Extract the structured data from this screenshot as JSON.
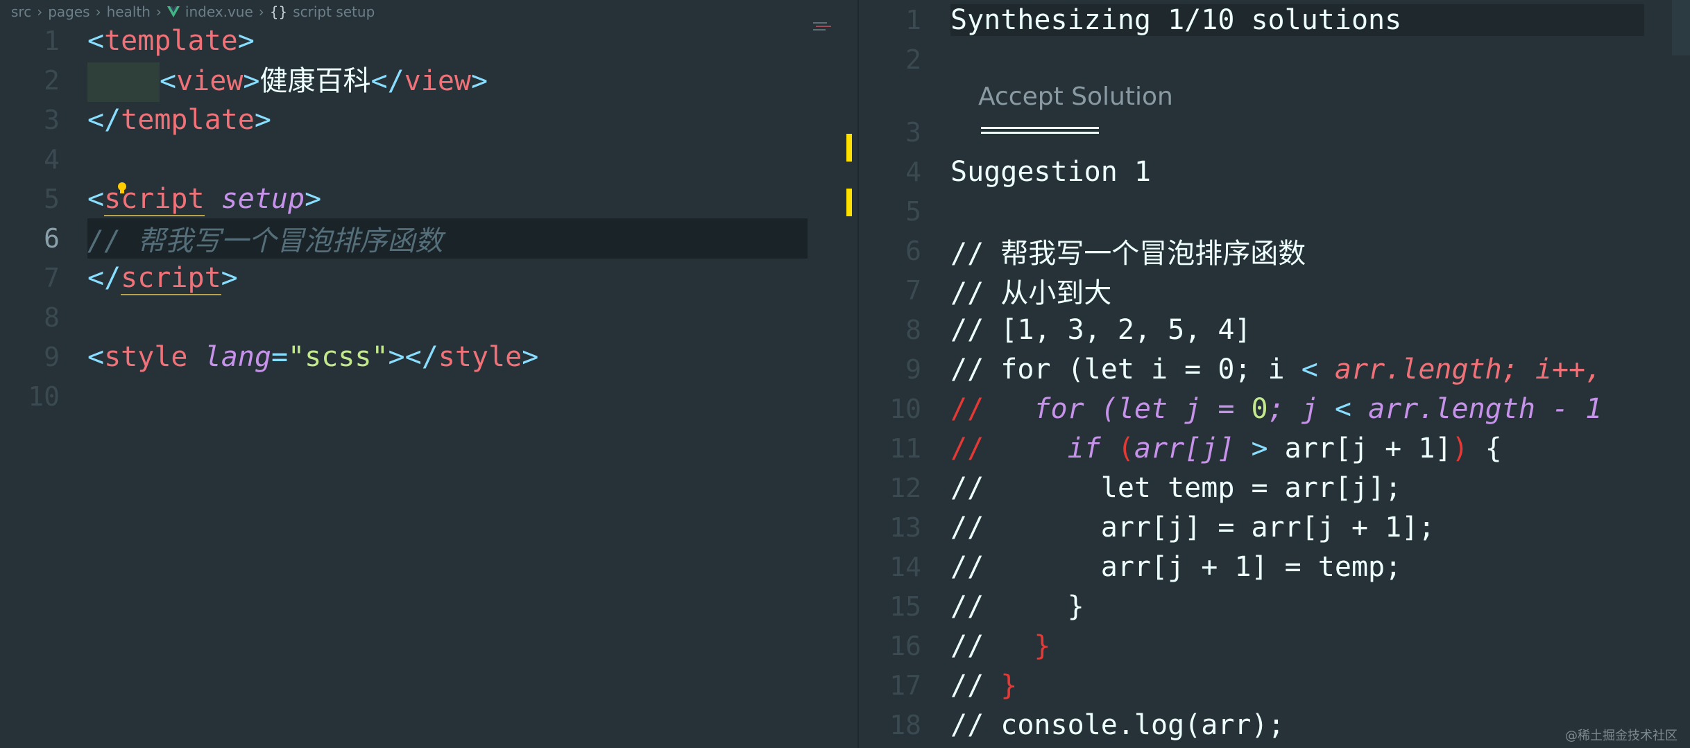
{
  "breadcrumb": [
    "src",
    "pages",
    "health",
    "index.vue",
    "script setup"
  ],
  "left_editor": {
    "line_numbers": [
      "1",
      "2",
      "3",
      "4",
      "5",
      "6",
      "7",
      "8",
      "9",
      "10"
    ],
    "active_line": "6",
    "lines": {
      "l1": {
        "open": "<",
        "tag": "template",
        "close": ">"
      },
      "l2": {
        "open": "<",
        "tag": "view",
        "close": ">",
        "text": "健康百科",
        "open2": "</",
        "tag2": "view",
        "close2": ">"
      },
      "l3": {
        "open": "</",
        "tag": "template",
        "close": ">"
      },
      "l5": {
        "open": "<",
        "tag": "script",
        "attr": "setup",
        "close": ">"
      },
      "l6": {
        "comment": "// 帮我写一个冒泡排序函数"
      },
      "l7": {
        "open": "</",
        "tag": "script",
        "close": ">"
      },
      "l9": {
        "open": "<",
        "tag": "style",
        "attr": "lang",
        "eq": "=",
        "str": "\"scss\"",
        "close": ">",
        "open2": "</",
        "tag2": "style",
        "close2": ">"
      }
    }
  },
  "right_panel": {
    "line_numbers": [
      "1",
      "2",
      "3",
      "4",
      "5",
      "6",
      "7",
      "8",
      "9",
      "10",
      "11",
      "12",
      "13",
      "14",
      "15",
      "16",
      "17",
      "18"
    ],
    "title": "Synthesizing 1/10 solutions",
    "accept_label": "Accept Solution",
    "suggestion": "Suggestion 1",
    "code": {
      "l6": "// 帮我写一个冒泡排序函数",
      "l7": "// 从小到大",
      "l8": "// [1, 3, 2, 5, 4]",
      "l9a": "// for (let i = 0; i ",
      "l9b": "< ",
      "l9c": "arr.length; i++,",
      "l10a": "//",
      "l10b": "   for (let j = ",
      "l10c": "0",
      "l10d": "; j ",
      "l10e": "< ",
      "l10f": "arr.length - 1",
      "l11a": "//",
      "l11b": "     if ",
      "l11c": "(",
      "l11d": "arr[j]",
      "l11e": " > ",
      "l11f": "arr[j + 1]",
      "l11g": ")",
      "l11h": " {",
      "l12": "//       let temp = arr[j];",
      "l13": "//       arr[j] = arr[j + 1];",
      "l14": "//       arr[j + 1] = temp;",
      "l15": "//     }",
      "l16a": "//   ",
      "l16b": "}",
      "l17a": "// ",
      "l17b": "}",
      "l18": "// console.log(arr);"
    }
  },
  "watermark": "@稀土掘金技术社区"
}
